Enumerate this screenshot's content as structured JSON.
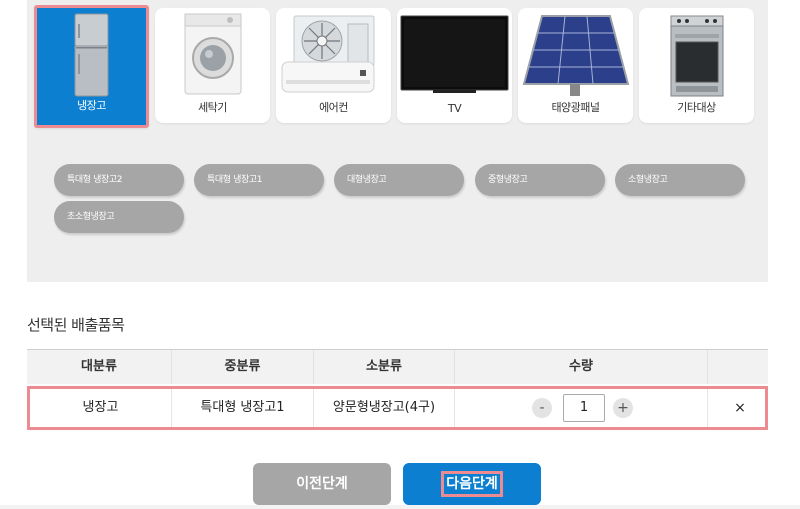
{
  "categories": [
    {
      "label": "냉장고",
      "icon": "fridge-icon",
      "selected": true
    },
    {
      "label": "세탁기",
      "icon": "washing-machine-icon",
      "selected": false
    },
    {
      "label": "에어컨",
      "icon": "air-conditioner-icon",
      "selected": false
    },
    {
      "label": "TV",
      "icon": "tv-icon",
      "selected": false
    },
    {
      "label": "태양광패널",
      "icon": "solar-panel-icon",
      "selected": false
    },
    {
      "label": "기타대상",
      "icon": "stove-icon",
      "selected": false
    }
  ],
  "subcategories": [
    "특대형 냉장고2",
    "특대형 냉장고1",
    "대형냉장고",
    "중형냉장고",
    "소형냉장고",
    "초소형냉장고"
  ],
  "selected_section": {
    "title": "선택된 배출품목",
    "headers": {
      "major": "대분류",
      "middle": "중분류",
      "minor": "소분류",
      "qty": "수량"
    },
    "rows": [
      {
        "major": "냉장고",
        "middle": "특대형 냉장고1",
        "minor": "양문형냉장고(4구)",
        "qty": "1",
        "minus": "-",
        "plus": "+",
        "remove": "×"
      }
    ]
  },
  "buttons": {
    "prev": "이전단계",
    "next": "다음단계"
  },
  "colors": {
    "accent": "#0c7fd0",
    "highlight": "#ec8c92",
    "chip": "#a6a6a6"
  }
}
